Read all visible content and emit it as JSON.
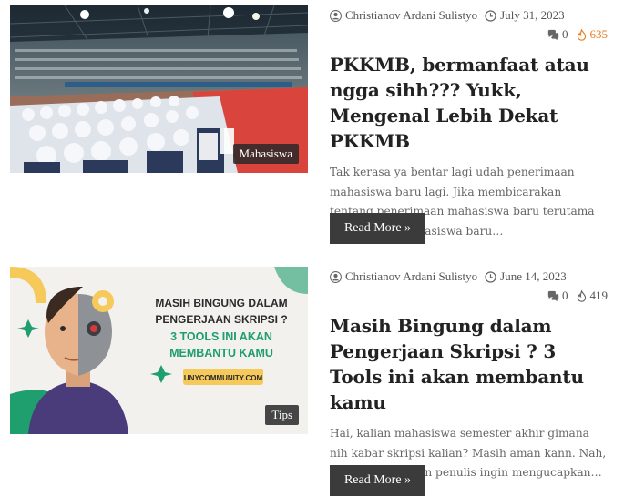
{
  "posts": [
    {
      "category": "Mahasiswa",
      "author": "Christianov Ardani Sulistyo",
      "date": "July 31, 2023",
      "comments": "0",
      "views": "635",
      "title": "PKKMB, bermanfaat atau ngga sihh??? Yukk, Mengenal Lebih Dekat PKKMB",
      "excerpt": "Tak kerasa ya bentar lagi udah penerimaan mahasiswa baru lagi. Jika membicarakan tentang penerimaan mahasiswa baru terutama penerimaan mahasiswa baru…",
      "read_more": "Read More »"
    },
    {
      "category": "Tips",
      "author": "Christianov Ardani Sulistyo",
      "date": "June 14, 2023",
      "comments": "0",
      "views": "419",
      "title": "Masih Bingung dalam Pengerjaan Skripsi ? 3 Tools ini akan membantu kamu",
      "excerpt": "Hai, kalian mahasiswa semester akhir gimana nih kabar skripsi kalian? Masih aman kann. Nah, kalau masih aman penulis ingin mengucapkan…",
      "read_more": "Read More »",
      "image_text": {
        "line1": "MASIH BINGUNG DALAM",
        "line2": "PENGERJAAN SKRIPSI ?",
        "line3": "3 TOOLS INI AKAN",
        "line4": "MEMBANTU KAMU",
        "site": "UNYCOMMUNITY.COM"
      }
    }
  ],
  "colors": {
    "hot": "#e67e22",
    "button": "#3b3b3b",
    "accent_green": "#1f9e6e",
    "accent_yellow": "#f5c95a"
  },
  "icons": [
    "user-icon",
    "clock-icon",
    "comments-icon",
    "fire-icon"
  ]
}
